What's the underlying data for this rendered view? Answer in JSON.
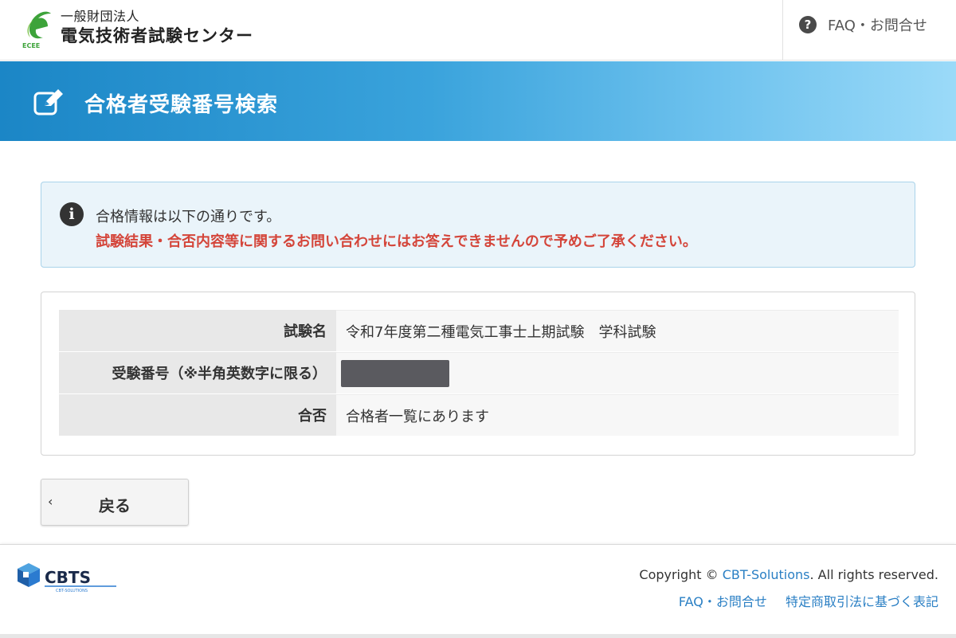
{
  "header": {
    "org_small": "一般財団法人",
    "org_large": "電気技術者試験センター",
    "logo_caption": "ECEE",
    "faq_label": "FAQ・お問合せ"
  },
  "banner": {
    "title": "合格者受験番号検索"
  },
  "info": {
    "line1": "合格情報は以下の通りです。",
    "line2": "試験結果・合否内容等に関するお問い合わせにはお答えできませんので予めご了承ください。"
  },
  "result": {
    "rows": [
      {
        "label": "試験名",
        "value": "令和7年度第二種電気工事士上期試験　学科試験"
      },
      {
        "label": "受験番号（※半角英数字に限る）",
        "value": ""
      },
      {
        "label": "合否",
        "value": "合格者一覧にあります"
      }
    ]
  },
  "back_button": {
    "label": "戻る"
  },
  "footer": {
    "logo_text": "CBTS",
    "logo_sub": "CBT-SOLUTIONS",
    "copyright_prefix": "Copyright © ",
    "copyright_link": "CBT-Solutions",
    "copyright_suffix": ". All rights reserved.",
    "links": [
      "FAQ・お問合せ",
      "特定商取引法に基づく表記"
    ]
  },
  "colors": {
    "banner_start": "#1b86c6",
    "banner_end": "#9bdaf8",
    "warning_red": "#d4453a",
    "link_blue": "#2a7fc4",
    "info_bg": "#eaf4fa"
  }
}
